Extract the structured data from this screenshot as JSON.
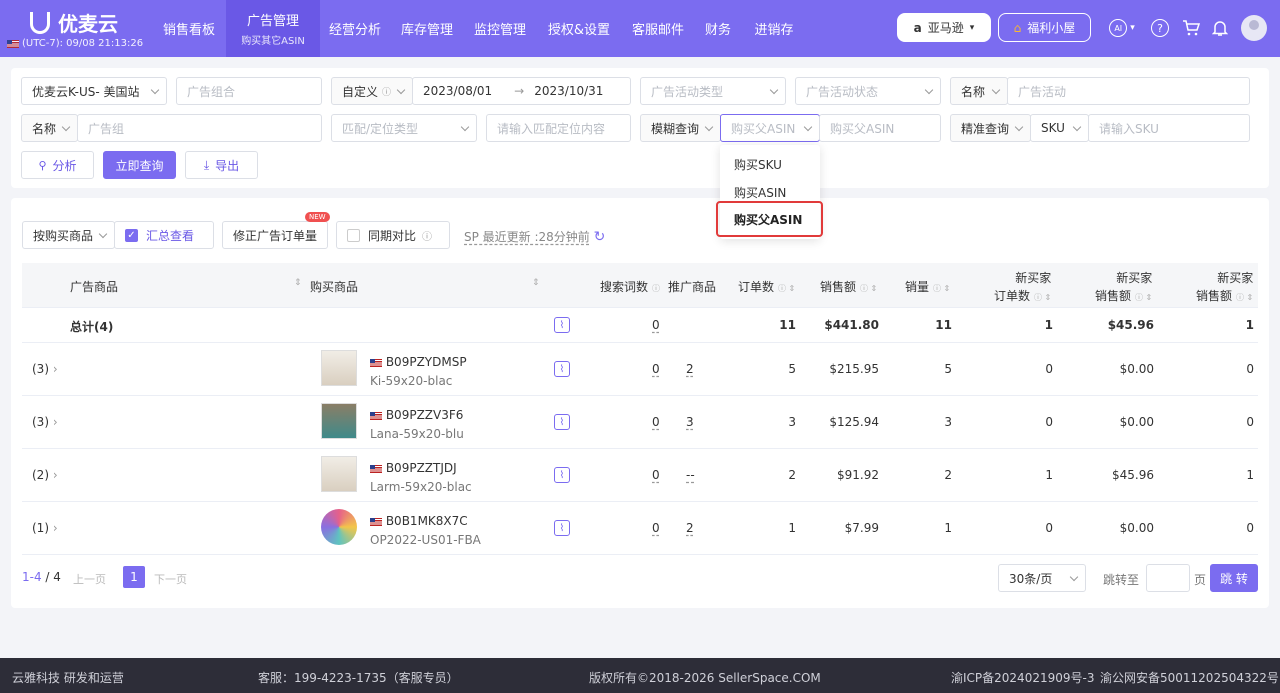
{
  "brand": {
    "name": "优麦云",
    "timezone": "(UTC-7): 09/08 21:13:26"
  },
  "nav": [
    {
      "label": "销售看板"
    },
    {
      "label": "广告管理",
      "sub": "购买其它ASIN"
    },
    {
      "label": "经营分析"
    },
    {
      "label": "库存管理"
    },
    {
      "label": "监控管理"
    },
    {
      "label": "授权&设置"
    },
    {
      "label": "客服邮件"
    },
    {
      "label": "财务"
    },
    {
      "label": "进销存"
    }
  ],
  "header": {
    "marketplace": "亚马逊",
    "welfare": "福利小屋",
    "ai": "AI"
  },
  "filters": {
    "shop": "优麦云K-US- 美国站",
    "ad_group_combo_ph": "广告组合",
    "date_mode": "自定义",
    "date_start": "2023/08/01",
    "date_sep": "→",
    "date_end": "2023/10/31",
    "campaign_type_ph": "广告活动类型",
    "campaign_status_ph": "广告活动状态",
    "name_label": "名称",
    "campaign_ph": "广告活动",
    "name_label2": "名称",
    "ad_group_ph": "广告组",
    "match_type_ph": "匹配/定位类型",
    "match_content_ph": "请输入匹配定位内容",
    "fuzzy": "模糊查询",
    "parent_asin_select": "购买父ASIN",
    "parent_asin_ph": "购买父ASIN",
    "exact": "精准查询",
    "sku_select": "SKU",
    "sku_ph": "请输入SKU",
    "analyze_btn": "分析",
    "query_btn": "立即查询",
    "export_btn": "导出"
  },
  "dropdown": {
    "items": [
      "购买SKU",
      "购买ASIN",
      "购买父ASIN"
    ]
  },
  "toolbar": {
    "group_by": "按购买商品",
    "summary": "汇总查看",
    "fix_orders": "修正广告订单量",
    "new_badge": "NEW",
    "compare": "同期对比",
    "update_text": "SP 最近更新 :28分钟前"
  },
  "table": {
    "headers": {
      "ad_product": "广告商品",
      "buy_product": "购买商品",
      "search_terms": "搜索词数",
      "promoted": "推广商品",
      "orders": "订单数",
      "sales": "销售额",
      "units": "销量",
      "nb_orders_1": "新买家",
      "nb_orders_2": "订单数",
      "nb_sales_1": "新买家",
      "nb_sales_2": "销售额",
      "nb_units_1": "新买家",
      "nb_units_2": "销售额"
    },
    "total": {
      "label": "总计(4)",
      "search_terms": "0",
      "orders": "11",
      "sales": "$441.80",
      "units": "11",
      "nb_orders": "1",
      "nb_sales": "$45.96",
      "nb_units": "1"
    },
    "rows": [
      {
        "count": "(3)",
        "asin": "B09PZYDMSP",
        "sku": "Ki-59x20-blac",
        "search_terms": "0",
        "promoted": "2",
        "orders": "5",
        "sales": "$215.95",
        "units": "5",
        "nb_orders": "0",
        "nb_sales": "$0.00",
        "nb_units": "0"
      },
      {
        "count": "(3)",
        "asin": "B09PZZV3F6",
        "sku": "Lana-59x20-blu",
        "search_terms": "0",
        "promoted": "3",
        "orders": "3",
        "sales": "$125.94",
        "units": "3",
        "nb_orders": "0",
        "nb_sales": "$0.00",
        "nb_units": "0"
      },
      {
        "count": "(2)",
        "asin": "B09PZZTJDJ",
        "sku": "Larm-59x20-blac",
        "search_terms": "0",
        "promoted": "--",
        "orders": "2",
        "sales": "$91.92",
        "units": "2",
        "nb_orders": "1",
        "nb_sales": "$45.96",
        "nb_units": "1"
      },
      {
        "count": "(1)",
        "asin": "B0B1MK8X7C",
        "sku": "OP2022-US01-FBA",
        "search_terms": "0",
        "promoted": "2",
        "orders": "1",
        "sales": "$7.99",
        "units": "1",
        "nb_orders": "0",
        "nb_sales": "$0.00",
        "nb_units": "0"
      }
    ]
  },
  "pagination": {
    "range": "1-4",
    "sep": " / ",
    "total": "4",
    "prev": "上一页",
    "page": "1",
    "next": "下一页",
    "per_page": "30条/页",
    "jump_to": "跳转至",
    "page_unit": "页",
    "go": "跳 转"
  },
  "footer": {
    "company": "云雅科技 研发和运营",
    "service": "客服：199-4223-1735（客服专员）",
    "copyright": "版权所有©2018-2026 SellerSpace.COM",
    "icp": "渝ICP备2024021909号-3",
    "police": "渝公网安备50011202504322号"
  }
}
